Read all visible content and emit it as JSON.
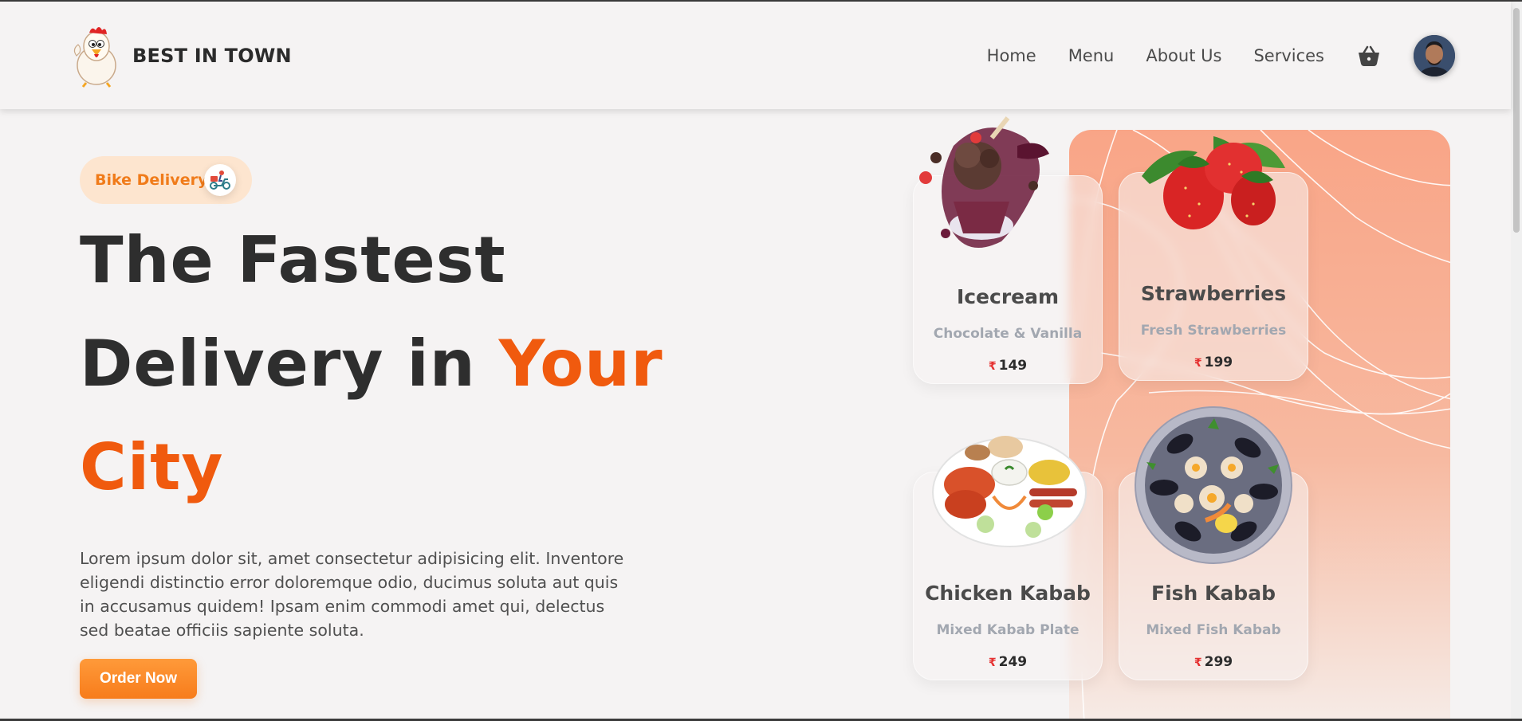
{
  "brand": {
    "name": "BEST IN TOWN",
    "logo_icon": "chicken-mascot-logo"
  },
  "nav": {
    "items": [
      {
        "label": "Home"
      },
      {
        "label": "Menu"
      },
      {
        "label": "About Us"
      },
      {
        "label": "Services"
      }
    ],
    "cart_icon": "basket-icon",
    "avatar_icon": "user-avatar"
  },
  "hero": {
    "badge": {
      "label": "Bike Delivery",
      "icon": "scooter-icon"
    },
    "headline_line1": "The Fastest",
    "headline_line2_prefix": "Delivery in",
    "headline_line2_accent": "Your",
    "headline_line3_accent": "City",
    "description": "Lorem ipsum dolor sit, amet consectetur adipisicing elit. Inventore eligendi distinctio error doloremque odio, ducimus soluta aut quis in accusamus quidem! Ipsam enim commodi amet qui, delectus sed beatae officiis sapiente soluta.",
    "cta_label": "Order Now"
  },
  "menu_cards": [
    {
      "title": "Icecream",
      "subtitle": "Chocolate & Vanilla",
      "currency": "₹",
      "price": "149",
      "image": "icecream-image"
    },
    {
      "title": "Strawberries",
      "subtitle": "Fresh Strawberries",
      "currency": "₹",
      "price": "199",
      "image": "strawberries-image"
    },
    {
      "title": "Chicken Kabab",
      "subtitle": "Mixed Kabab Plate",
      "currency": "₹",
      "price": "249",
      "image": "chicken-kabab-image"
    },
    {
      "title": "Fish Kabab",
      "subtitle": "Mixed Fish Kabab",
      "currency": "₹",
      "price": "299",
      "image": "fish-kabab-image"
    }
  ],
  "colors": {
    "accent": "#f05a0e",
    "badge_bg": "#fde5cf",
    "badge_text": "#f07b1a",
    "button": "#f77c1b",
    "hero_panel_top": "#f9a98a",
    "hero_panel_bottom": "#f7ede9",
    "page_bg": "#f5f3f3"
  }
}
